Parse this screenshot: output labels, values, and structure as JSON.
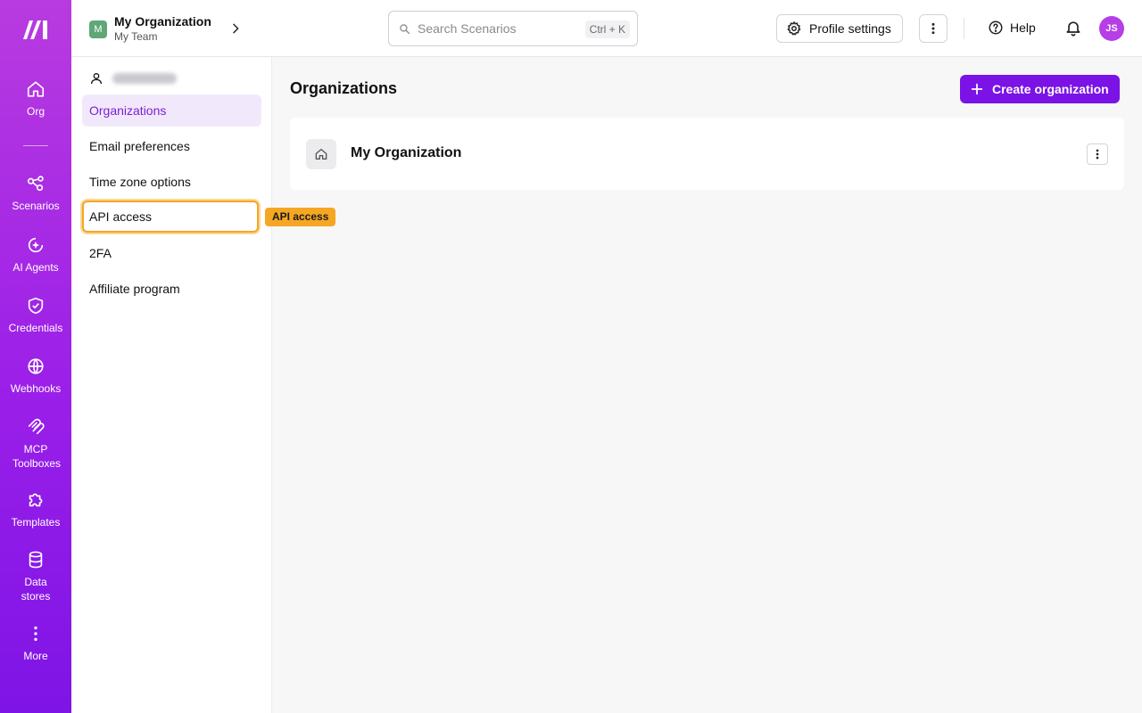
{
  "rail": {
    "items": [
      {
        "label": "Org",
        "icon": "home-icon"
      },
      {
        "label": "Scenarios",
        "icon": "share-nodes-icon"
      },
      {
        "label": "AI Agents",
        "icon": "ai-agent-icon"
      },
      {
        "label": "Credentials",
        "icon": "shield-check-icon"
      },
      {
        "label": "Webhooks",
        "icon": "globe-icon"
      },
      {
        "label": "MCP Toolboxes",
        "icon": "mcp-icon"
      },
      {
        "label": "Templates",
        "icon": "puzzle-icon"
      },
      {
        "label": "Data stores",
        "icon": "database-icon"
      },
      {
        "label": "More",
        "icon": "more-vertical-icon"
      }
    ]
  },
  "header": {
    "org_badge": "M",
    "org_name": "My Organization",
    "team_name": "My Team",
    "search_placeholder": "Search Scenarios",
    "search_shortcut": "Ctrl + K",
    "profile_settings_label": "Profile settings",
    "help_label": "Help",
    "avatar_initials": "JS"
  },
  "sidebar": {
    "items": [
      {
        "label": "Organizations",
        "state": "active"
      },
      {
        "label": "Email preferences"
      },
      {
        "label": "Time zone options"
      },
      {
        "label": "API access",
        "state": "focused"
      },
      {
        "label": "2FA"
      },
      {
        "label": "Affiliate program"
      }
    ],
    "tooltip": "API access"
  },
  "main": {
    "title": "Organizations",
    "create_button_label": "Create organization",
    "organizations": [
      {
        "name": "My Organization",
        "icon": "home-icon"
      }
    ]
  },
  "colors": {
    "accent": "#7b12e6",
    "rail_gradient_top": "#b83be0",
    "rail_gradient_bottom": "#7e14e6",
    "focus_ring": "#f5a623",
    "active_nav_bg": "#f1e9fb",
    "org_badge": "#5fa777",
    "avatar": "#b53ee6"
  }
}
